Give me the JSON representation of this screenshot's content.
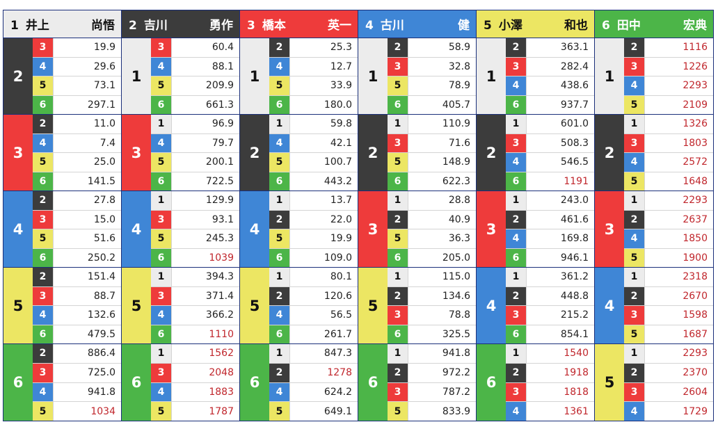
{
  "colors": {
    "1": "#ececec",
    "2": "#3c3c3c",
    "3": "#ee3b3b",
    "4": "#3f86d6",
    "5": "#ece663",
    "6": "#4cb548",
    "high_odds_text": "#c0262c",
    "border": "#1a2f7a"
  },
  "columns": [
    {
      "boat": "1",
      "family": "井上",
      "given": "尚悟",
      "groups": [
        {
          "second": "2",
          "rows": [
            {
              "third": "3",
              "odds": "19.9"
            },
            {
              "third": "4",
              "odds": "29.6"
            },
            {
              "third": "5",
              "odds": "73.1"
            },
            {
              "third": "6",
              "odds": "297.1"
            }
          ]
        },
        {
          "second": "3",
          "rows": [
            {
              "third": "2",
              "odds": "11.0"
            },
            {
              "third": "4",
              "odds": "7.4"
            },
            {
              "third": "5",
              "odds": "25.0"
            },
            {
              "third": "6",
              "odds": "141.5"
            }
          ]
        },
        {
          "second": "4",
          "rows": [
            {
              "third": "2",
              "odds": "27.8"
            },
            {
              "third": "3",
              "odds": "15.0"
            },
            {
              "third": "5",
              "odds": "51.6"
            },
            {
              "third": "6",
              "odds": "250.2"
            }
          ]
        },
        {
          "second": "5",
          "rows": [
            {
              "third": "2",
              "odds": "151.4"
            },
            {
              "third": "3",
              "odds": "88.7"
            },
            {
              "third": "4",
              "odds": "132.6"
            },
            {
              "third": "6",
              "odds": "479.5"
            }
          ]
        },
        {
          "second": "6",
          "rows": [
            {
              "third": "2",
              "odds": "886.4"
            },
            {
              "third": "3",
              "odds": "725.0"
            },
            {
              "third": "4",
              "odds": "941.8"
            },
            {
              "third": "5",
              "odds": "1034"
            }
          ]
        }
      ]
    },
    {
      "boat": "2",
      "family": "吉川",
      "given": "勇作",
      "groups": [
        {
          "second": "1",
          "rows": [
            {
              "third": "3",
              "odds": "60.4"
            },
            {
              "third": "4",
              "odds": "88.1"
            },
            {
              "third": "5",
              "odds": "209.9"
            },
            {
              "third": "6",
              "odds": "661.3"
            }
          ]
        },
        {
          "second": "3",
          "rows": [
            {
              "third": "1",
              "odds": "96.9"
            },
            {
              "third": "4",
              "odds": "79.7"
            },
            {
              "third": "5",
              "odds": "200.1"
            },
            {
              "third": "6",
              "odds": "722.5"
            }
          ]
        },
        {
          "second": "4",
          "rows": [
            {
              "third": "1",
              "odds": "129.9"
            },
            {
              "third": "3",
              "odds": "93.1"
            },
            {
              "third": "5",
              "odds": "245.3"
            },
            {
              "third": "6",
              "odds": "1039"
            }
          ]
        },
        {
          "second": "5",
          "rows": [
            {
              "third": "1",
              "odds": "394.3"
            },
            {
              "third": "3",
              "odds": "371.4"
            },
            {
              "third": "4",
              "odds": "366.2"
            },
            {
              "third": "6",
              "odds": "1110"
            }
          ]
        },
        {
          "second": "6",
          "rows": [
            {
              "third": "1",
              "odds": "1562"
            },
            {
              "third": "3",
              "odds": "2048"
            },
            {
              "third": "4",
              "odds": "1883"
            },
            {
              "third": "5",
              "odds": "1787"
            }
          ]
        }
      ]
    },
    {
      "boat": "3",
      "family": "橋本",
      "given": "英一",
      "groups": [
        {
          "second": "1",
          "rows": [
            {
              "third": "2",
              "odds": "25.3"
            },
            {
              "third": "4",
              "odds": "12.7"
            },
            {
              "third": "5",
              "odds": "33.9"
            },
            {
              "third": "6",
              "odds": "180.0"
            }
          ]
        },
        {
          "second": "2",
          "rows": [
            {
              "third": "1",
              "odds": "59.8"
            },
            {
              "third": "4",
              "odds": "42.1"
            },
            {
              "third": "5",
              "odds": "100.7"
            },
            {
              "third": "6",
              "odds": "443.2"
            }
          ]
        },
        {
          "second": "4",
          "rows": [
            {
              "third": "1",
              "odds": "13.7"
            },
            {
              "third": "2",
              "odds": "22.0"
            },
            {
              "third": "5",
              "odds": "19.9"
            },
            {
              "third": "6",
              "odds": "109.0"
            }
          ]
        },
        {
          "second": "5",
          "rows": [
            {
              "third": "1",
              "odds": "80.1"
            },
            {
              "third": "2",
              "odds": "120.6"
            },
            {
              "third": "4",
              "odds": "56.5"
            },
            {
              "third": "6",
              "odds": "261.7"
            }
          ]
        },
        {
          "second": "6",
          "rows": [
            {
              "third": "1",
              "odds": "847.3"
            },
            {
              "third": "2",
              "odds": "1278"
            },
            {
              "third": "4",
              "odds": "624.2"
            },
            {
              "third": "5",
              "odds": "649.1"
            }
          ]
        }
      ]
    },
    {
      "boat": "4",
      "family": "古川",
      "given": "健",
      "groups": [
        {
          "second": "1",
          "rows": [
            {
              "third": "2",
              "odds": "58.9"
            },
            {
              "third": "3",
              "odds": "32.8"
            },
            {
              "third": "5",
              "odds": "78.9"
            },
            {
              "third": "6",
              "odds": "405.7"
            }
          ]
        },
        {
          "second": "2",
          "rows": [
            {
              "third": "1",
              "odds": "110.9"
            },
            {
              "third": "3",
              "odds": "71.6"
            },
            {
              "third": "5",
              "odds": "148.9"
            },
            {
              "third": "6",
              "odds": "622.3"
            }
          ]
        },
        {
          "second": "3",
          "rows": [
            {
              "third": "1",
              "odds": "28.8"
            },
            {
              "third": "2",
              "odds": "40.9"
            },
            {
              "third": "5",
              "odds": "36.3"
            },
            {
              "third": "6",
              "odds": "205.0"
            }
          ]
        },
        {
          "second": "5",
          "rows": [
            {
              "third": "1",
              "odds": "115.0"
            },
            {
              "third": "2",
              "odds": "134.6"
            },
            {
              "third": "3",
              "odds": "78.8"
            },
            {
              "third": "6",
              "odds": "325.5"
            }
          ]
        },
        {
          "second": "6",
          "rows": [
            {
              "third": "1",
              "odds": "941.8"
            },
            {
              "third": "2",
              "odds": "972.2"
            },
            {
              "third": "3",
              "odds": "787.2"
            },
            {
              "third": "5",
              "odds": "833.9"
            }
          ]
        }
      ]
    },
    {
      "boat": "5",
      "family": "小澤",
      "given": "和也",
      "groups": [
        {
          "second": "1",
          "rows": [
            {
              "third": "2",
              "odds": "363.1"
            },
            {
              "third": "3",
              "odds": "282.4"
            },
            {
              "third": "4",
              "odds": "438.6"
            },
            {
              "third": "6",
              "odds": "937.7"
            }
          ]
        },
        {
          "second": "2",
          "rows": [
            {
              "third": "1",
              "odds": "601.0"
            },
            {
              "third": "3",
              "odds": "508.3"
            },
            {
              "third": "4",
              "odds": "546.5"
            },
            {
              "third": "6",
              "odds": "1191"
            }
          ]
        },
        {
          "second": "3",
          "rows": [
            {
              "third": "1",
              "odds": "243.0"
            },
            {
              "third": "2",
              "odds": "461.6"
            },
            {
              "third": "4",
              "odds": "169.8"
            },
            {
              "third": "6",
              "odds": "946.1"
            }
          ]
        },
        {
          "second": "4",
          "rows": [
            {
              "third": "1",
              "odds": "361.2"
            },
            {
              "third": "2",
              "odds": "448.8"
            },
            {
              "third": "3",
              "odds": "215.2"
            },
            {
              "third": "6",
              "odds": "854.1"
            }
          ]
        },
        {
          "second": "6",
          "rows": [
            {
              "third": "1",
              "odds": "1540"
            },
            {
              "third": "2",
              "odds": "1918"
            },
            {
              "third": "3",
              "odds": "1818"
            },
            {
              "third": "4",
              "odds": "1361"
            }
          ]
        }
      ]
    },
    {
      "boat": "6",
      "family": "田中",
      "given": "宏典",
      "groups": [
        {
          "second": "1",
          "rows": [
            {
              "third": "2",
              "odds": "1116"
            },
            {
              "third": "3",
              "odds": "1226"
            },
            {
              "third": "4",
              "odds": "2293"
            },
            {
              "third": "5",
              "odds": "2109"
            }
          ]
        },
        {
          "second": "2",
          "rows": [
            {
              "third": "1",
              "odds": "1326"
            },
            {
              "third": "3",
              "odds": "1803"
            },
            {
              "third": "4",
              "odds": "2572"
            },
            {
              "third": "5",
              "odds": "1648"
            }
          ]
        },
        {
          "second": "3",
          "rows": [
            {
              "third": "1",
              "odds": "2293"
            },
            {
              "third": "2",
              "odds": "2637"
            },
            {
              "third": "4",
              "odds": "1850"
            },
            {
              "third": "5",
              "odds": "1900"
            }
          ]
        },
        {
          "second": "4",
          "rows": [
            {
              "third": "1",
              "odds": "2318"
            },
            {
              "third": "2",
              "odds": "2670"
            },
            {
              "third": "3",
              "odds": "1598"
            },
            {
              "third": "5",
              "odds": "1687"
            }
          ]
        },
        {
          "second": "5",
          "rows": [
            {
              "third": "1",
              "odds": "2293"
            },
            {
              "third": "2",
              "odds": "2370"
            },
            {
              "third": "3",
              "odds": "2604"
            },
            {
              "third": "4",
              "odds": "1729"
            }
          ]
        }
      ]
    }
  ]
}
